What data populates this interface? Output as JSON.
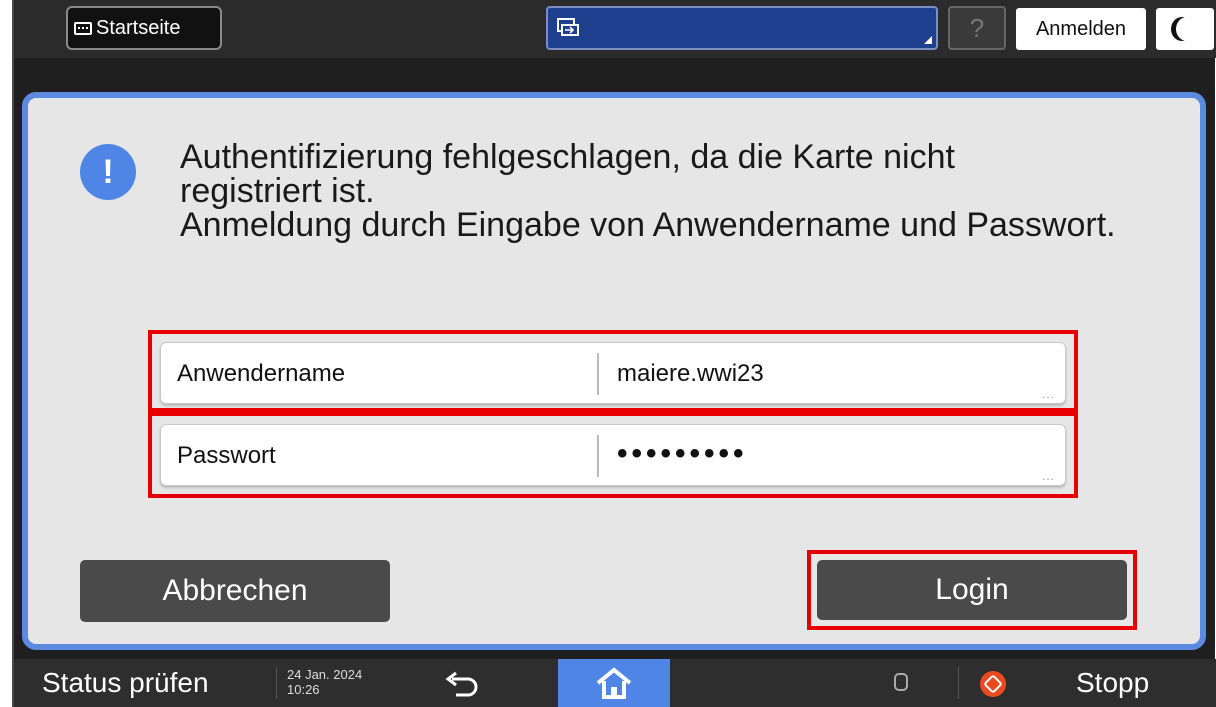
{
  "topbar": {
    "home_label": "Startseite",
    "help_label": "?",
    "login_label": "Anmelden",
    "screen_select_icon": "screen-switch-icon",
    "sleep_icon": "moon-icon"
  },
  "dialog": {
    "icon": "info-exclamation-icon",
    "message_line1": "Authentifizierung fehlgeschlagen, da die Karte nicht",
    "message_line2": "registriert ist.",
    "message_line3": "Anmeldung durch Eingabe von Anwendername und Passwort.",
    "username_label": "Anwendername",
    "username_value": "maiere.wwi23",
    "password_label": "Passwort",
    "password_value": "•••••••••",
    "field_more": "...",
    "cancel_label": "Abbrechen",
    "login_label": "Login"
  },
  "bottombar": {
    "status_label": "Status prüfen",
    "date": "24 Jan. 2024",
    "time": "10:26",
    "stop_label": "Stopp"
  },
  "colors": {
    "accent": "#4f86e6",
    "highlight": "#e60000",
    "stop": "#e84b1f"
  }
}
